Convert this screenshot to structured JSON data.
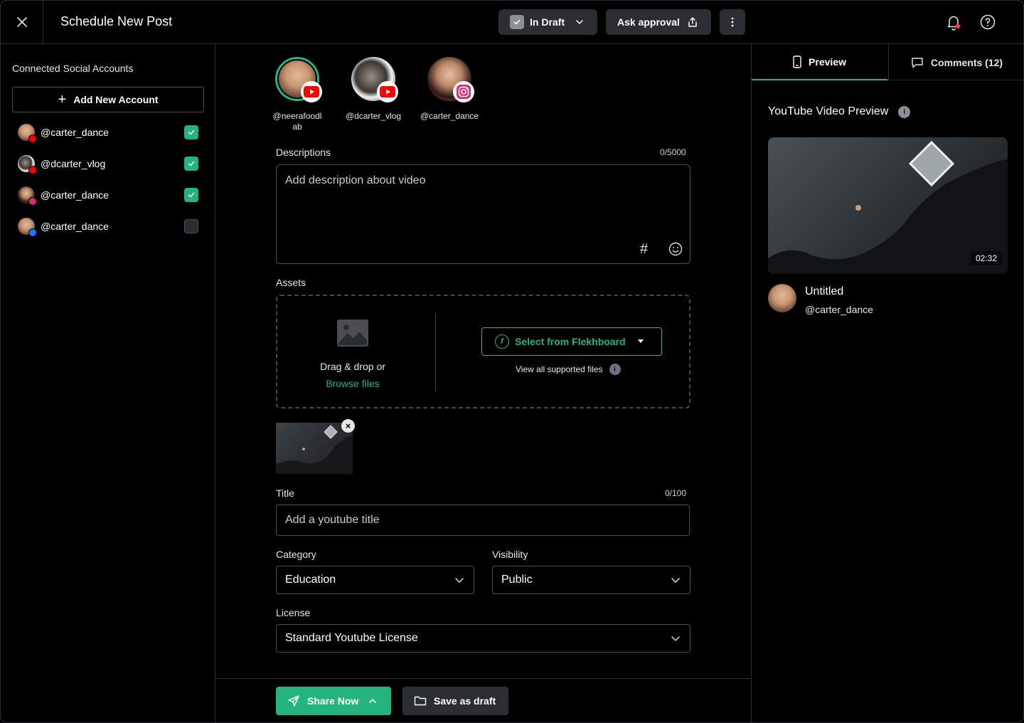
{
  "header": {
    "title": "Schedule New Post",
    "status_label": "In Draft",
    "approval_label": "Ask approval"
  },
  "sidebar": {
    "title": "Connected Social Accounts",
    "add_label": "Add New Account",
    "accounts": [
      {
        "handle": "@carter_dance",
        "network": "youtube",
        "checked": true
      },
      {
        "handle": "@dcarter_vlog",
        "network": "youtube",
        "checked": true
      },
      {
        "handle": "@carter_dance",
        "network": "instagram",
        "checked": true
      },
      {
        "handle": "@carter_dance",
        "network": "facebook",
        "checked": false
      }
    ]
  },
  "selected_accounts": [
    {
      "handle": "@neerafoodlab",
      "network": "youtube",
      "active": true
    },
    {
      "handle": "@dcarter_vlog",
      "network": "youtube",
      "active": false
    },
    {
      "handle": "@carter_dance",
      "network": "instagram",
      "active": false
    }
  ],
  "descriptions": {
    "label": "Descriptions",
    "counter": "0/5000",
    "placeholder": "Add description about video"
  },
  "assets": {
    "label": "Assets",
    "drag_text": "Drag & drop or",
    "browse_label": "Browse files",
    "select_label": "Select from Flekhboard",
    "supported_label": "View all supported files"
  },
  "title_field": {
    "label": "Title",
    "counter": "0/100",
    "placeholder": "Add a youtube title"
  },
  "category": {
    "label": "Category",
    "value": "Education"
  },
  "visibility": {
    "label": "Visibility",
    "value": "Public"
  },
  "license": {
    "label": "License",
    "value": "Standard Youtube License"
  },
  "footer": {
    "share_label": "Share Now",
    "save_label": "Save as draft"
  },
  "right_panel": {
    "tab_preview": "Preview",
    "tab_comments": "Comments (12)",
    "preview_title": "YouTube Video Preview",
    "duration": "02:32",
    "video_title": "Untitled",
    "video_handle": "@carter_dance"
  },
  "colors": {
    "accent": "#24b47e",
    "youtube": "#ff0000",
    "instagram": "#d62976",
    "facebook": "#1877f2",
    "notification_dot": "#ff3b3b"
  }
}
